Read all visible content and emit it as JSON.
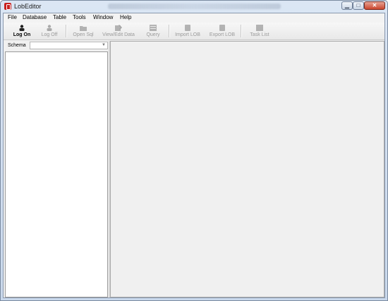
{
  "window": {
    "title": "LobEditor",
    "caption_blurred": true,
    "buttons": [
      "minimize",
      "maximize",
      "close"
    ]
  },
  "menu": [
    "File",
    "Database",
    "Table",
    "Tools",
    "Window",
    "Help"
  ],
  "toolbar": [
    {
      "label": "Log On",
      "enabled": true,
      "icon": "user-icon"
    },
    {
      "label": "Log Off",
      "enabled": false,
      "icon": "user-icon"
    },
    {
      "label": "Open Sql",
      "enabled": false,
      "icon": "folder-icon"
    },
    {
      "label": "View/Edit Data",
      "enabled": false,
      "icon": "edit-icon"
    },
    {
      "label": "Query",
      "enabled": false,
      "icon": "query-icon"
    },
    {
      "label": "Import LOB",
      "enabled": false,
      "icon": "import-icon"
    },
    {
      "label": "Export LOB",
      "enabled": false,
      "icon": "export-icon"
    },
    {
      "label": "Task List",
      "enabled": false,
      "icon": "list-icon"
    }
  ],
  "left": {
    "schema_label": "Schema",
    "schema_value": ""
  }
}
